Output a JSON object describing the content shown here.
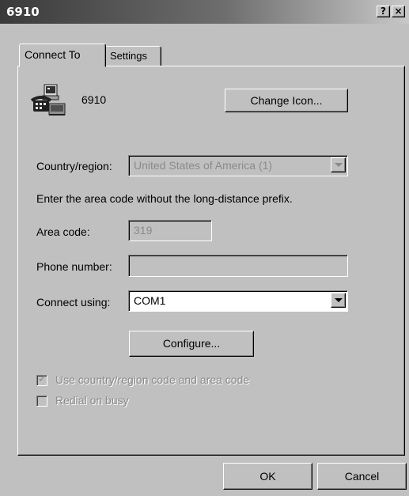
{
  "window": {
    "title": "6910",
    "help_button": "?",
    "close_button": "×"
  },
  "tabs": [
    {
      "label": "Connect To",
      "active": true
    },
    {
      "label": "Settings",
      "active": false
    }
  ],
  "connection": {
    "name": "6910",
    "icon": "phone-computer-icon",
    "change_icon_label": "Change Icon..."
  },
  "country": {
    "label": "Country/region:",
    "value": "United States of America (1)"
  },
  "area_hint": "Enter the area code without the long-distance prefix.",
  "area_code": {
    "label": "Area code:",
    "value": "319"
  },
  "phone_number": {
    "label": "Phone number:",
    "value": ""
  },
  "connect_using": {
    "label": "Connect using:",
    "value": "COM1"
  },
  "configure_label": "Configure...",
  "checkboxes": [
    {
      "label": "Use country/region code and area code",
      "checked": true,
      "enabled": false
    },
    {
      "label": "Redial on busy",
      "checked": false,
      "enabled": false
    }
  ],
  "footer": {
    "ok_label": "OK",
    "cancel_label": "Cancel"
  }
}
